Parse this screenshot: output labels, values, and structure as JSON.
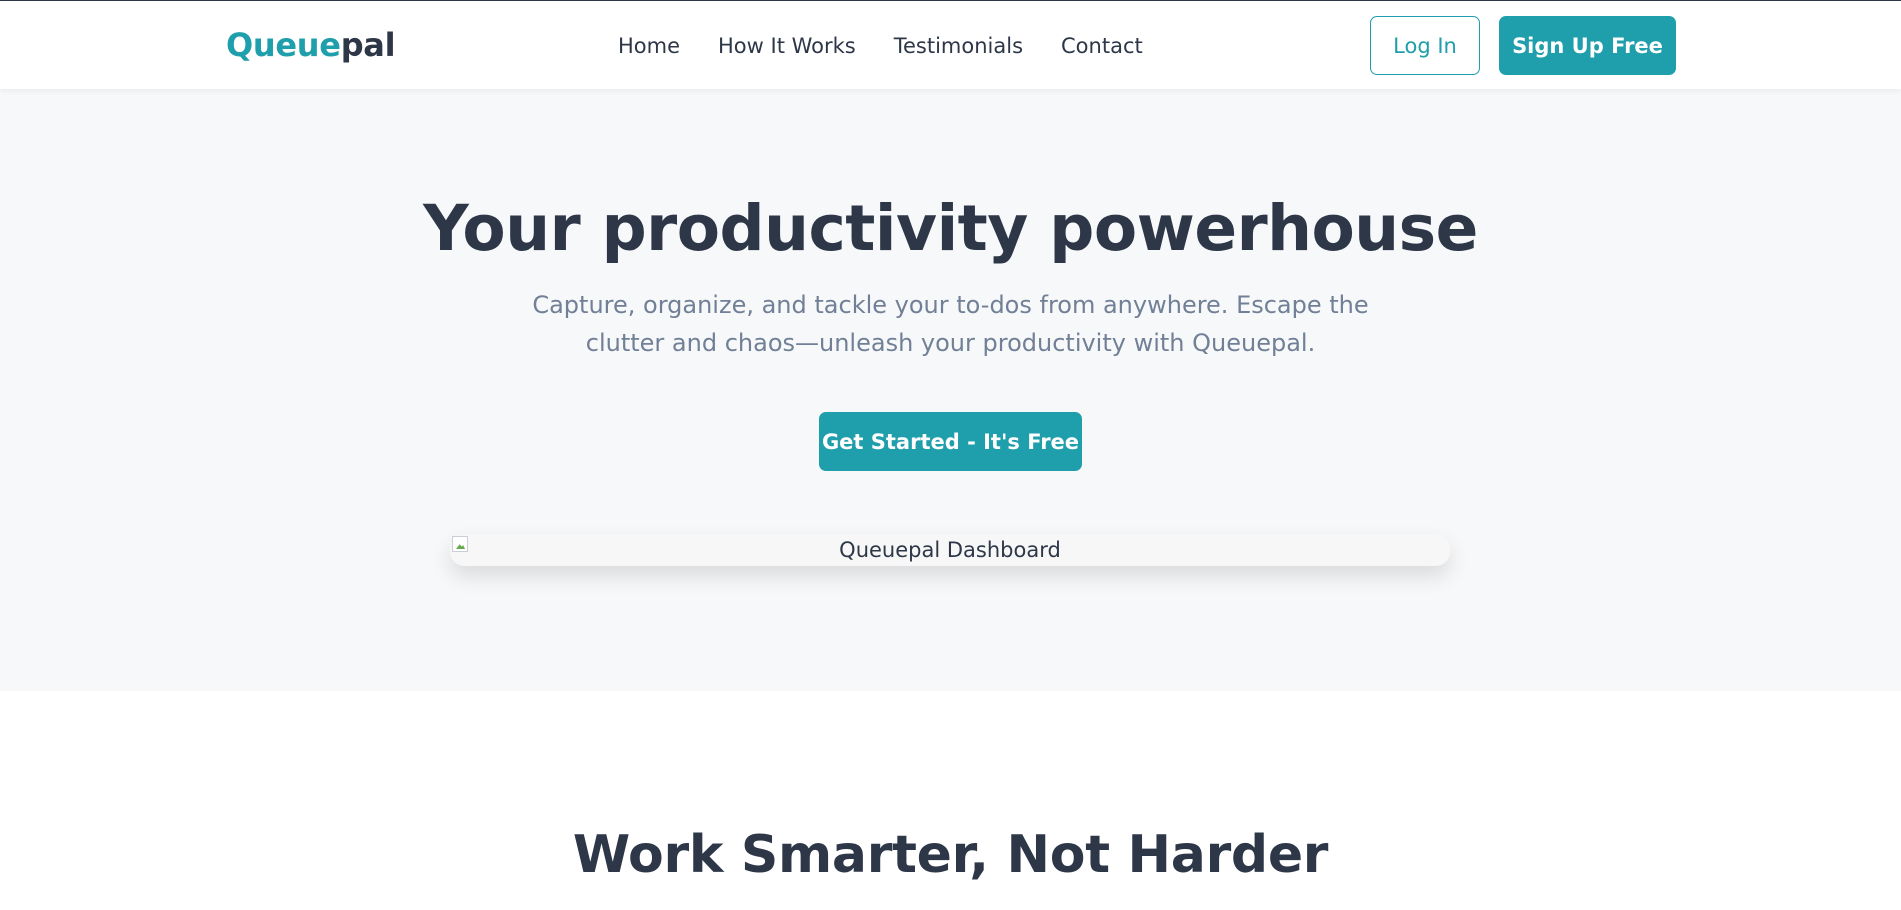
{
  "brand": {
    "name_part_a": "Queue",
    "name_part_b": "pal",
    "accent_color": "#1f9eab",
    "dark_color": "#2d3748"
  },
  "nav": {
    "items": [
      {
        "label": "Home"
      },
      {
        "label": "How It Works"
      },
      {
        "label": "Testimonials"
      },
      {
        "label": "Contact"
      }
    ]
  },
  "auth": {
    "login_label": "Log In",
    "signup_label": "Sign Up Free"
  },
  "hero": {
    "title": "Your productivity powerhouse",
    "subtitle": "Capture, organize, and tackle your to-dos from anywhere. Escape the clutter and chaos—unleash your productivity with Queuepal.",
    "cta_label": "Get Started - It's Free",
    "image_alt": "Queuepal Dashboard",
    "background_color": "#f7f8fa"
  },
  "section2": {
    "title": "Work Smarter, Not Harder"
  }
}
